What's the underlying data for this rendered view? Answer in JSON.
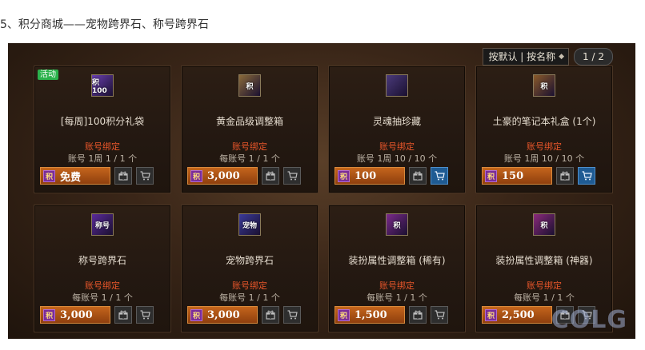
{
  "caption": "5、积分商城——宠物跨界石、称号跨界石",
  "sortbar": {
    "sort_label": "按默认 | 按名称",
    "sort_arrow": "◆",
    "pager": "1 / 2"
  },
  "coin_label": "积",
  "gift_icon": "gift-icon",
  "cart_icon": "cart-icon",
  "watermark": "COLG",
  "items": [
    {
      "badge": "活动",
      "name": "[每周]100积分礼袋",
      "bind": "账号绑定",
      "limit": "账号 1周 1 / 1 个",
      "price": "免费",
      "cart_active": false,
      "icon_text": "积100",
      "icon_color": "#6a3fb0"
    },
    {
      "badge": "",
      "name": "黄金品级调整箱",
      "bind": "账号绑定",
      "limit": "每账号 1 / 1 个",
      "price": "3,000",
      "cart_active": false,
      "icon_text": "积",
      "icon_color": "#8a6a3a"
    },
    {
      "badge": "",
      "name": "灵魂抽珍藏",
      "bind": "账号绑定",
      "limit": "账号 1周 10 / 10 个",
      "price": "100",
      "cart_active": true,
      "icon_text": "",
      "icon_color": "#4a3a7a"
    },
    {
      "badge": "",
      "name": "土豪的笔记本礼盒 (1个)",
      "bind": "账号绑定",
      "limit": "账号 1周 10 / 10 个",
      "price": "150",
      "cart_active": true,
      "icon_text": "积",
      "icon_color": "#8a5a2a"
    },
    {
      "badge": "",
      "name": "称号跨界石",
      "bind": "账号绑定",
      "limit": "每账号 1 / 1 个",
      "price": "3,000",
      "cart_active": false,
      "icon_text": "称号",
      "icon_color": "#5a2a9a"
    },
    {
      "badge": "",
      "name": "宠物跨界石",
      "bind": "账号绑定",
      "limit": "每账号 1 / 1 个",
      "price": "3,000",
      "cart_active": false,
      "icon_text": "宠物",
      "icon_color": "#3a3a9a"
    },
    {
      "badge": "",
      "name": "装扮属性调整箱 (稀有)",
      "bind": "账号绑定",
      "limit": "每账号 1 / 1 个",
      "price": "1,500",
      "cart_active": false,
      "icon_text": "积",
      "icon_color": "#7a2a8a"
    },
    {
      "badge": "",
      "name": "装扮属性调整箱 (神器)",
      "bind": "账号绑定",
      "limit": "每账号 1 / 1 个",
      "price": "2,500",
      "cart_active": false,
      "icon_text": "积",
      "icon_color": "#8a2a7a"
    }
  ]
}
